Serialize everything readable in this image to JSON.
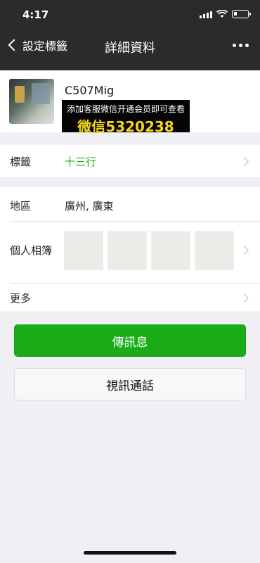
{
  "status_bar": {
    "time": "4:17"
  },
  "nav": {
    "back_label": "設定標籤",
    "title": "詳細資料"
  },
  "profile": {
    "name": "C507Mig"
  },
  "promo": {
    "line1": "添加客服微信开通会员即可查看",
    "line2": "微信5320238"
  },
  "rows": {
    "tags": {
      "label": "標籤",
      "value": "十三行"
    },
    "region": {
      "label": "地區",
      "value": "廣州, 廣東"
    },
    "album": {
      "label": "個人相簿"
    },
    "more": {
      "label": "更多"
    }
  },
  "buttons": {
    "message": "傳訊息",
    "video_call": "視訊通話"
  },
  "colors": {
    "header_bg": "#2b2b2b",
    "primary_green": "#1aad19",
    "tag_green": "#1aad19",
    "promo_yellow": "#f4d51b"
  }
}
